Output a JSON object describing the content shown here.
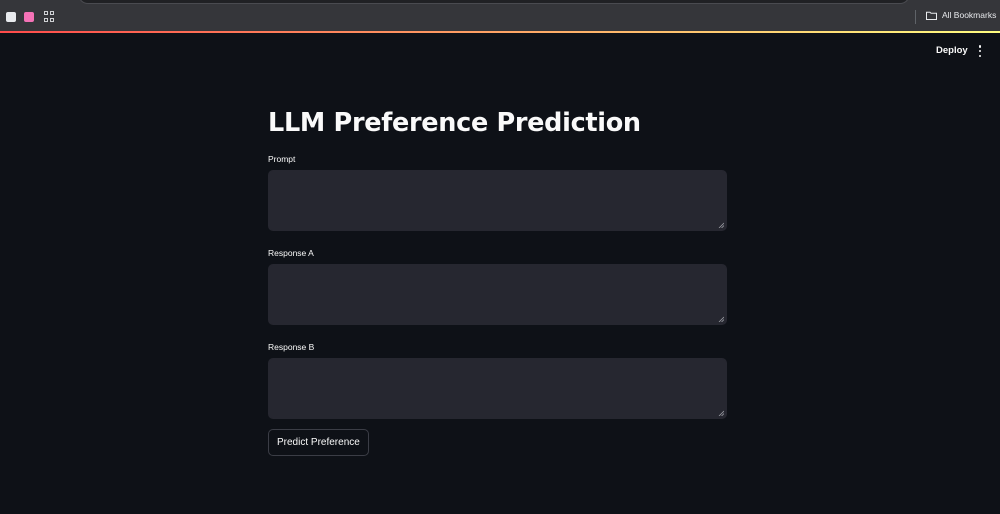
{
  "browser": {
    "bookmarks_bar": {
      "items": [
        {
          "icon": "blank-page-icon",
          "color": "#e8eaed"
        },
        {
          "icon": "pink-square-icon",
          "color": "#f472b6"
        },
        {
          "icon": "apps-grid-icon"
        }
      ],
      "all_bookmarks_label": "All Bookmarks",
      "all_bookmarks_icon": "folder-icon"
    }
  },
  "header": {
    "deploy_label": "Deploy",
    "menu_icon": "kebab-menu-icon"
  },
  "theme": {
    "background": "#0e1117",
    "input_background": "#262730",
    "text": "#fafafa",
    "decoration_start": "#ff4b4b",
    "decoration_end": "#fffd80"
  },
  "main": {
    "title": "LLM Preference Prediction",
    "fields": [
      {
        "label": "Prompt",
        "value": ""
      },
      {
        "label": "Response A",
        "value": ""
      },
      {
        "label": "Response B",
        "value": ""
      }
    ],
    "submit_label": "Predict Preference"
  }
}
